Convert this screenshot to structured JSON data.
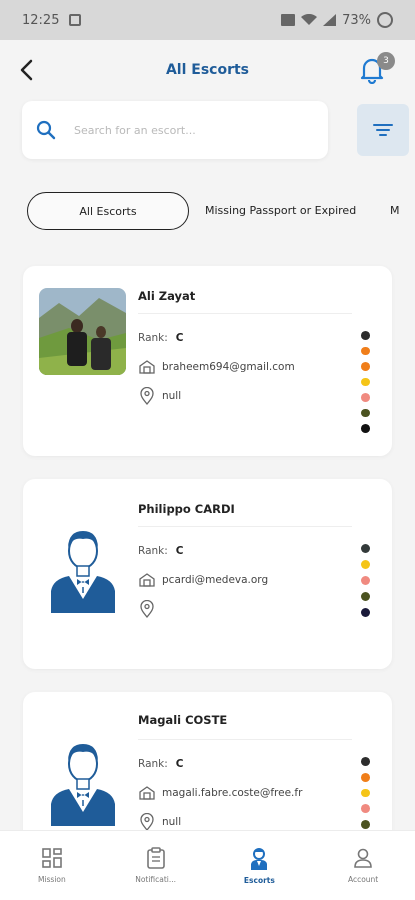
{
  "statusbar": {
    "time": "12:25",
    "battery": "73%"
  },
  "header": {
    "title": "All Escorts",
    "notification_count": "3"
  },
  "search": {
    "placeholder": "Search for an escort..."
  },
  "tabs": [
    {
      "label": "All Escorts"
    },
    {
      "label": "Missing Passport or Expired"
    },
    {
      "label": "M"
    }
  ],
  "escorts": [
    {
      "name": "Ali Zayat",
      "rank_label": "Rank:",
      "rank": "C",
      "email": "braheem694@gmail.com",
      "location": "null",
      "dots": [
        "#2d2d2d",
        "#f07e1a",
        "#f07e1a",
        "#f5c518",
        "#f08a80",
        "#4b5320",
        "#111111"
      ]
    },
    {
      "name": "Philippo CARDI",
      "rank_label": "Rank:",
      "rank": "C",
      "email": "pcardi@medeva.org",
      "location": "",
      "dots": [
        "#333a3a",
        "#f5c518",
        "#f08a80",
        "#4b5320",
        "#1a1a3a"
      ]
    },
    {
      "name": "Magali COSTE",
      "rank_label": "Rank:",
      "rank": "C",
      "email": "magali.fabre.coste@free.fr",
      "location": "null",
      "dots": [
        "#2d2d2d",
        "#f07e1a",
        "#f5c518",
        "#f08a80",
        "#4b5320"
      ]
    }
  ],
  "nav": [
    {
      "label": "Mission",
      "icon": "grid-icon"
    },
    {
      "label": "Notificati...",
      "icon": "clipboard-icon"
    },
    {
      "label": "Escorts",
      "icon": "escort-icon"
    },
    {
      "label": "Account",
      "icon": "person-icon"
    }
  ],
  "colors": {
    "primary": "#1f5c99",
    "filter_bg": "#dde7f0"
  }
}
